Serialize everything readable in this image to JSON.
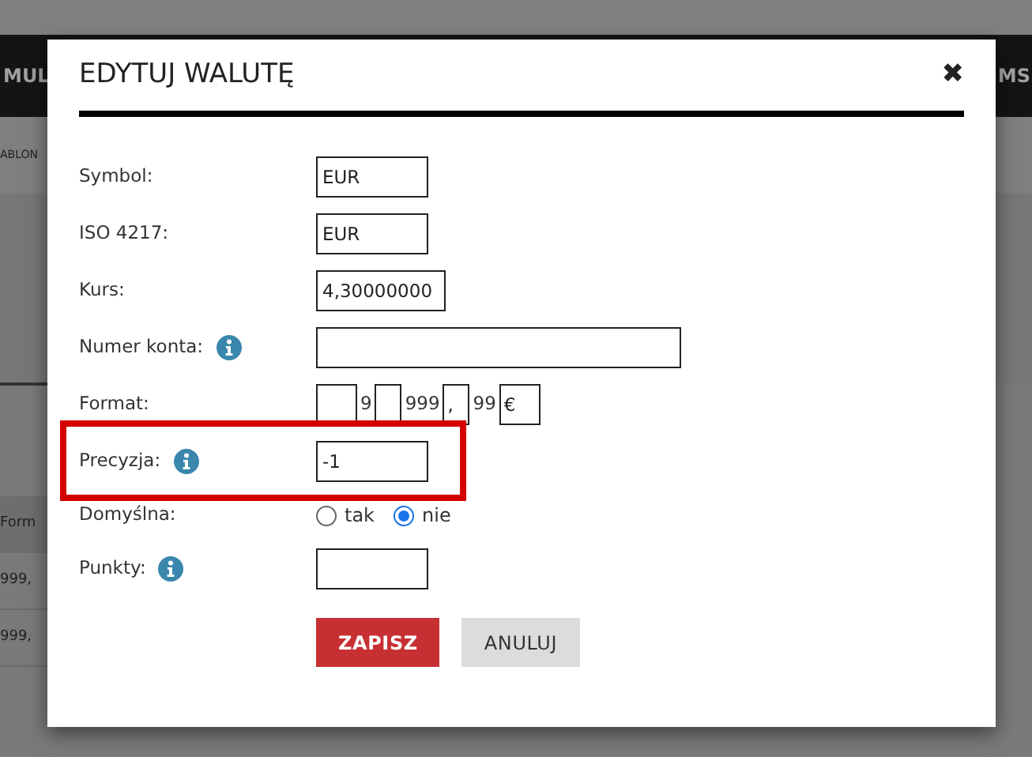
{
  "background": {
    "nav_left": "MUL",
    "nav_right": "MS",
    "breadcrumb": "ABLON",
    "table_header": "Form",
    "table_rows": [
      "999,",
      "999,"
    ]
  },
  "dialog": {
    "title": "EDYTUJ WALUTĘ",
    "close": "✖",
    "rows": [
      {
        "kind": "input",
        "label": "Symbol:",
        "value": "EUR"
      },
      {
        "kind": "input",
        "label": "ISO 4217:",
        "value": "EUR"
      },
      {
        "kind": "input",
        "label": "Kurs:",
        "value": "4,30000000"
      },
      {
        "kind": "input",
        "label": "Numer konta:",
        "info": true
      },
      {
        "kind": "format",
        "label": "Format:",
        "parts": [
          {
            "kind": "field"
          },
          {
            "kind": "text",
            "value": "9"
          },
          {
            "kind": "field"
          },
          {
            "kind": "text",
            "value": "999"
          },
          {
            "kind": "field",
            "value": ","
          },
          {
            "kind": "text",
            "value": "99"
          },
          {
            "kind": "field",
            "value": "€"
          }
        ]
      },
      {
        "kind": "input",
        "label": "Precyzja:",
        "info": true,
        "highlight": true,
        "value": "-1"
      },
      {
        "kind": "radio",
        "label": "Domyślna:",
        "options": [
          {
            "label": "tak",
            "selected": false
          },
          {
            "label": "nie",
            "selected": true
          }
        ]
      },
      {
        "kind": "input",
        "label": "Punkty:",
        "info": true
      }
    ],
    "buttons": [
      {
        "label": "ZAPISZ",
        "kind": "primary"
      },
      {
        "label": "ANULUJ",
        "kind": "secondary"
      }
    ]
  }
}
